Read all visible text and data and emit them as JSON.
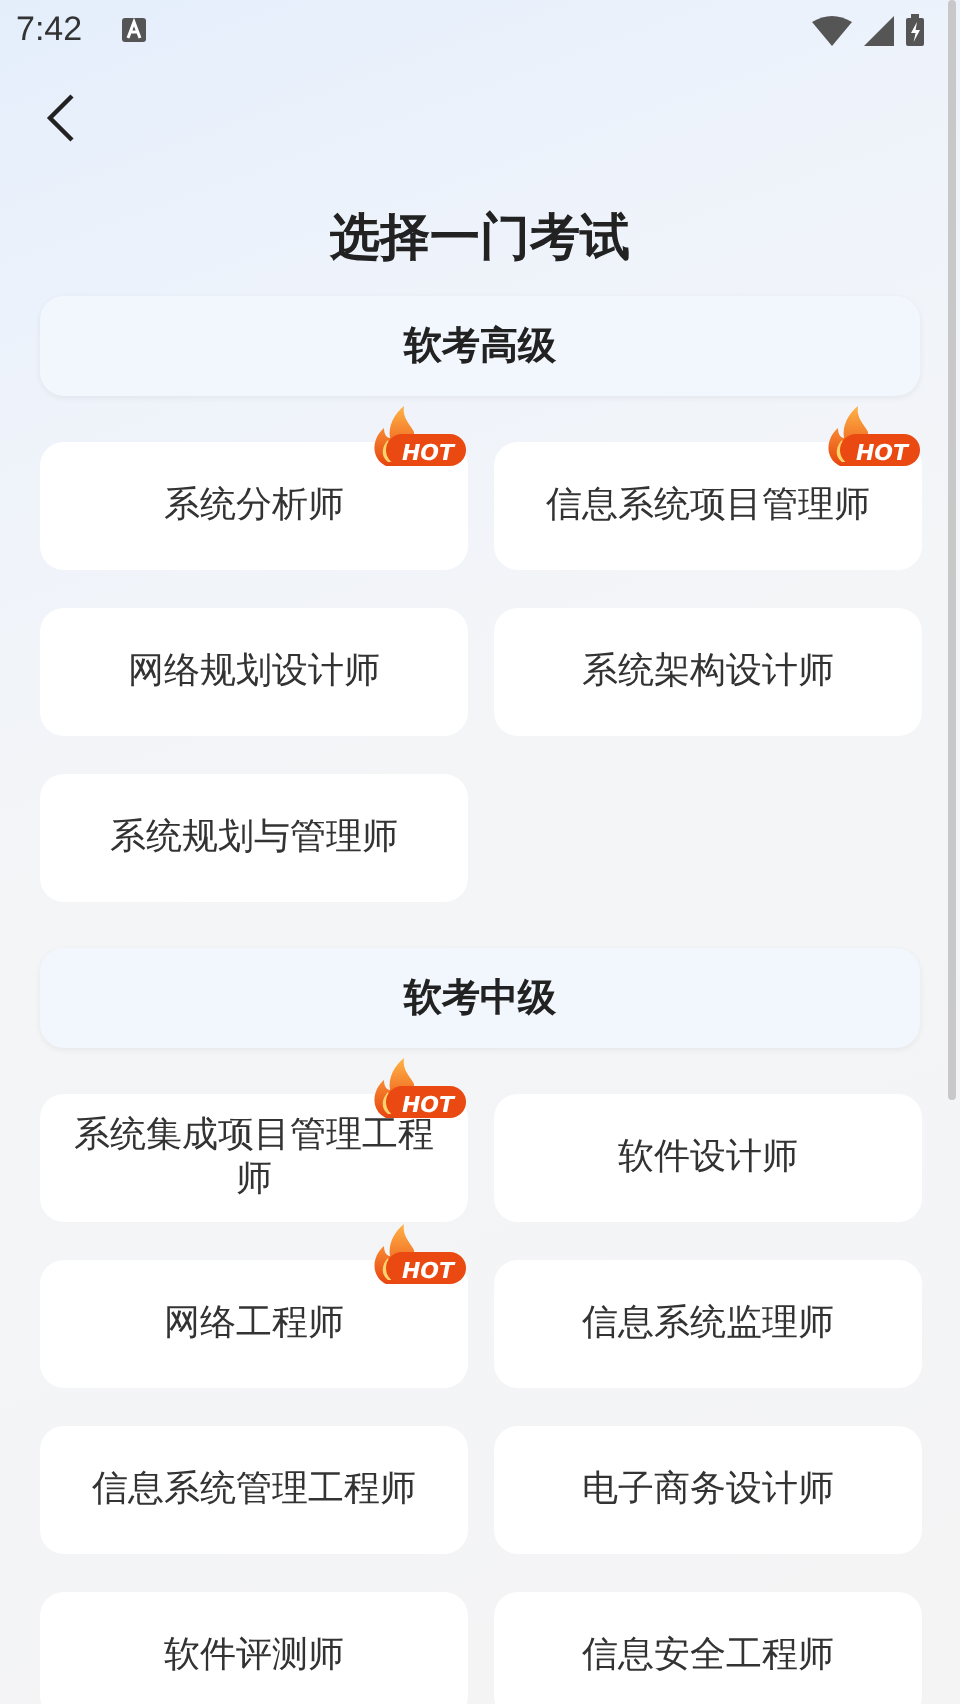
{
  "status_bar": {
    "time": "7:42"
  },
  "title": "选择一门考试",
  "sections": [
    {
      "heading": "软考高级",
      "exams": [
        {
          "name": "系统分析师",
          "badge": "HOT"
        },
        {
          "name": "信息系统项目管理师",
          "badge": "HOT"
        },
        {
          "name": "网络规划设计师"
        },
        {
          "name": "系统架构设计师"
        },
        {
          "name": "系统规划与管理师"
        }
      ]
    },
    {
      "heading": "软考中级",
      "exams": [
        {
          "name": "系统集成项目管理工程师",
          "badge": "HOT"
        },
        {
          "name": "软件设计师"
        },
        {
          "name": "网络工程师",
          "badge": "HOT"
        },
        {
          "name": "信息系统监理师"
        },
        {
          "name": "信息系统管理工程师"
        },
        {
          "name": "电子商务设计师"
        },
        {
          "name": "软件评测师"
        },
        {
          "name": "信息安全工程师"
        }
      ]
    }
  ]
}
